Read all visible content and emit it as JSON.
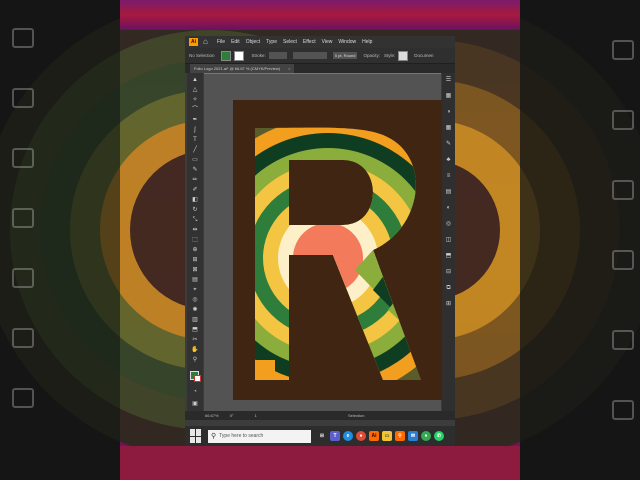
{
  "menu": {
    "items": [
      "File",
      "Edit",
      "Object",
      "Type",
      "Select",
      "Effect",
      "View",
      "Window",
      "Help"
    ]
  },
  "control_bar": {
    "selection_label": "No Selection",
    "stroke_label": "Stroke:",
    "stroke_weight": "5 pt. Round",
    "opacity_label": "Opacity:",
    "style_label": "Style:",
    "document_label": "Documen"
  },
  "document_tab": {
    "title": "Folio Logo 2021.ai* @ 66.67 % (CMYK/Preview)",
    "close": "×"
  },
  "status_bar": {
    "zoom": "66.67%",
    "rotation": "0°",
    "page": "1",
    "tool": "Selection"
  },
  "taskbar": {
    "search_placeholder": "Type here to search",
    "apps": [
      {
        "name": "task-view",
        "label": "⊞",
        "color": "#2d2d2d"
      },
      {
        "name": "teams",
        "label": "T",
        "color": "#5b5fc7"
      },
      {
        "name": "edge",
        "label": "e",
        "color": "#1f8ee0"
      },
      {
        "name": "chrome",
        "label": "●",
        "color": "#dd4b39"
      },
      {
        "name": "illustrator",
        "label": "Ai",
        "color": "#ff6a00"
      },
      {
        "name": "explorer",
        "label": "▭",
        "color": "#f4c430"
      },
      {
        "name": "app-search",
        "label": "⚲",
        "color": "#ff6a00"
      },
      {
        "name": "mail",
        "label": "✉",
        "color": "#2d7dd2"
      },
      {
        "name": "chrome-2",
        "label": "●",
        "color": "#34a853"
      },
      {
        "name": "whatsapp",
        "label": "✆",
        "color": "#25d366"
      }
    ]
  },
  "colors": {
    "artboard": "#402513",
    "stripes": [
      "#e52b2b",
      "#f29e1f",
      "#f4c542",
      "#ffffff",
      "#fdefc8",
      "#f37a5a",
      "#8aad3c",
      "#2e7d3a",
      "#0f3d22",
      "#5a5d2a"
    ]
  }
}
